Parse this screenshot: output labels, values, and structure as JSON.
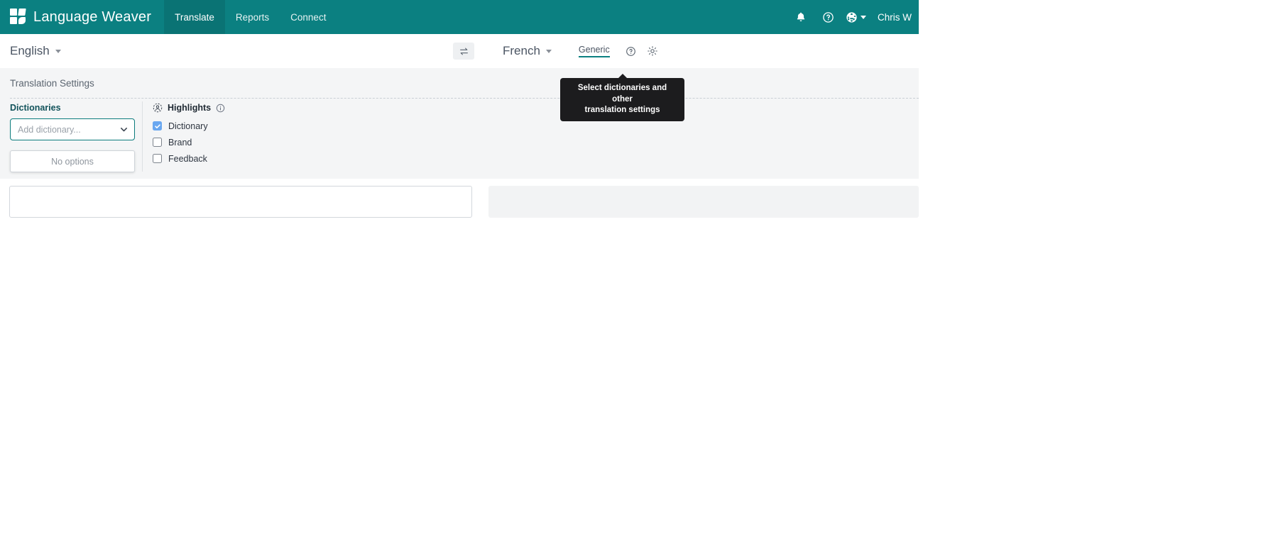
{
  "header": {
    "brand": "Language Weaver",
    "logo_icon": "language-weaver-logo",
    "nav": [
      {
        "label": "Translate",
        "active": true
      },
      {
        "label": "Reports",
        "active": false
      },
      {
        "label": "Connect",
        "active": false
      }
    ],
    "notifications_icon": "bell-icon",
    "help_icon": "question-circle-icon",
    "language_icon": "globe-icon",
    "language_caret_icon": "caret-down-icon",
    "user_name": "Chris W",
    "bar_color": "#0b8081",
    "active_tab_color": "#0a7374"
  },
  "language_bar": {
    "source_language": "English",
    "source_caret_icon": "chevron-down-icon",
    "swap_icon": "swap-horizontal-icon",
    "target_language": "French",
    "target_caret_icon": "chevron-down-icon",
    "model_tab": "Generic",
    "model_help_icon": "question-circle-icon",
    "settings_icon": "gear-icon",
    "accent_color": "#0b8081"
  },
  "settings_panel": {
    "title": "Translation Settings",
    "dictionaries": {
      "label": "Dictionaries",
      "placeholder": "Add dictionary...",
      "value": "",
      "caret_icon": "chevron-down-icon",
      "dropdown_empty_text": "No options",
      "focus_border_color": "#0b7b7c"
    },
    "highlights": {
      "icon": "highlights-user-icon",
      "title": "Highlights",
      "info_icon": "info-circle-icon",
      "options": [
        {
          "label": "Dictionary",
          "checked": true
        },
        {
          "label": "Brand",
          "checked": false
        },
        {
          "label": "Feedback",
          "checked": false
        }
      ],
      "checked_color": "#69a7f0"
    }
  },
  "tooltip": {
    "line1": "Select dictionaries and other",
    "line2": "translation settings"
  },
  "editor": {
    "source_placeholder": "",
    "target_placeholder": ""
  }
}
